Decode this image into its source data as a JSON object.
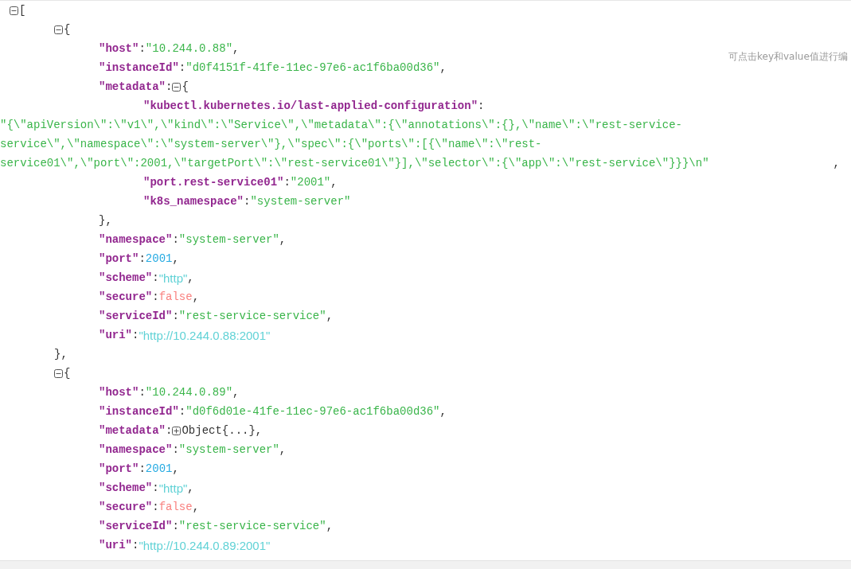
{
  "hint": "可点击key和value值进行编",
  "tree": {
    "kind": "array",
    "expanded": true,
    "open": "[",
    "children": [
      {
        "kind": "object",
        "expanded": true,
        "open": "{",
        "close": "},",
        "children": [
          {
            "key": "\"host\"",
            "sep": ":",
            "kind": "string",
            "value": "\"10.244.0.88\"",
            "end": ","
          },
          {
            "key": "\"instanceId\"",
            "sep": ":",
            "kind": "string",
            "value": "\"d0f4151f-41fe-11ec-97e6-ac1f6ba00d36\"",
            "end": ","
          },
          {
            "key": "\"metadata\"",
            "sep": ":",
            "kind": "object",
            "expanded": true,
            "open": "{",
            "close": "},",
            "children": [
              {
                "key": "\"kubectl.kubernetes.io/last-applied-configuration\"",
                "sep": ":",
                "kind": "string",
                "value": "\"{\\\"apiVersion\\\":\\\"v1\\\",\\\"kind\\\":\\\"Service\\\",\\\"metadata\\\":{\\\"annotations\\\":{},\\\"name\\\":\\\"rest-service-service\\\",\\\"namespace\\\":\\\"system-server\\\"},\\\"spec\\\":{\\\"ports\\\":[{\\\"name\\\":\\\"rest-service01\\\",\\\"port\\\":2001,\\\"targetPort\\\":\\\"rest-service01\\\"}],\\\"selector\\\":{\\\"app\\\":\\\"rest-service\\\"}}}\\n\"",
                "end": ","
              },
              {
                "key": "\"port.rest-service01\"",
                "sep": ":",
                "kind": "string",
                "value": "\"2001\"",
                "end": ","
              },
              {
                "key": "\"k8s_namespace\"",
                "sep": ":",
                "kind": "string",
                "value": "\"system-server\""
              }
            ]
          },
          {
            "key": "\"namespace\"",
            "sep": ":",
            "kind": "string",
            "value": "\"system-server\"",
            "end": ","
          },
          {
            "key": "\"port\"",
            "sep": ":",
            "kind": "number",
            "value": "2001",
            "end": ","
          },
          {
            "key": "\"scheme\"",
            "sep": ":",
            "kind": "url",
            "value": "\"http\"",
            "end": ","
          },
          {
            "key": "\"secure\"",
            "sep": ":",
            "kind": "boolean",
            "value": "false",
            "end": ","
          },
          {
            "key": "\"serviceId\"",
            "sep": ":",
            "kind": "string",
            "value": "\"rest-service-service\"",
            "end": ","
          },
          {
            "key": "\"uri\"",
            "sep": ":",
            "kind": "url",
            "value": "\"http://10.244.0.88:2001\""
          }
        ]
      },
      {
        "kind": "object",
        "expanded": true,
        "open": "{",
        "children": [
          {
            "key": "\"host\"",
            "sep": ":",
            "kind": "string",
            "value": "\"10.244.0.89\"",
            "end": ","
          },
          {
            "key": "\"instanceId\"",
            "sep": ":",
            "kind": "string",
            "value": "\"d0f6d01e-41fe-11ec-97e6-ac1f6ba00d36\"",
            "end": ","
          },
          {
            "key": "\"metadata\"",
            "sep": ":",
            "kind": "object",
            "expanded": false,
            "summary": "Object{...}",
            "end": ","
          },
          {
            "key": "\"namespace\"",
            "sep": ":",
            "kind": "string",
            "value": "\"system-server\"",
            "end": ","
          },
          {
            "key": "\"port\"",
            "sep": ":",
            "kind": "number",
            "value": "2001",
            "end": ","
          },
          {
            "key": "\"scheme\"",
            "sep": ":",
            "kind": "url",
            "value": "\"http\"",
            "end": ","
          },
          {
            "key": "\"secure\"",
            "sep": ":",
            "kind": "boolean",
            "value": "false",
            "end": ","
          },
          {
            "key": "\"serviceId\"",
            "sep": ":",
            "kind": "string",
            "value": "\"rest-service-service\"",
            "end": ","
          },
          {
            "key": "\"uri\"",
            "sep": ":",
            "kind": "url",
            "value": "\"http://10.244.0.89:2001\""
          }
        ]
      }
    ]
  }
}
